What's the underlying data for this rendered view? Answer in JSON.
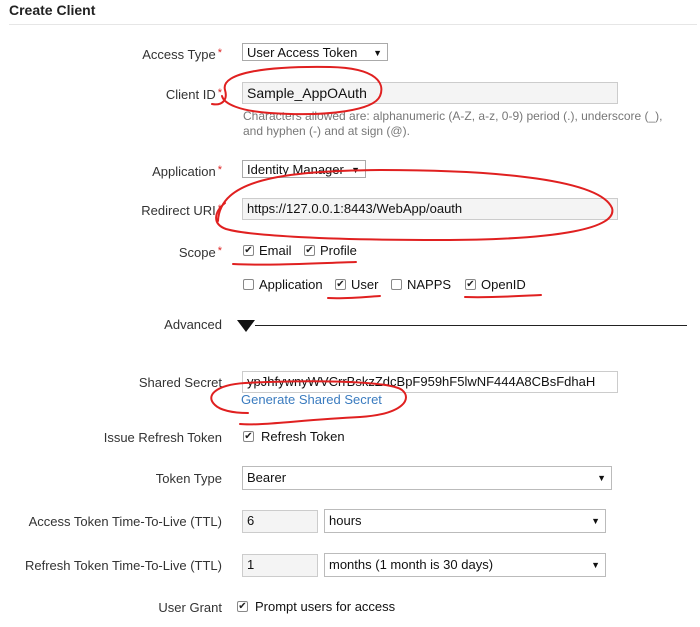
{
  "form": {
    "title": "Create Client",
    "access_type": {
      "label": "Access Type",
      "value": "User Access Token"
    },
    "client_id": {
      "label": "Client ID",
      "value": "Sample_AppOAuth",
      "help_line1": "Characters allowed are: alphanumeric (A-Z, a-z, 0-9) period (.), underscore (_),",
      "help_line2": "and hyphen (-) and at sign (@)."
    },
    "application": {
      "label": "Application",
      "value": "Identity Manager"
    },
    "redirect_uri": {
      "label": "Redirect URI",
      "value": "https://127.0.0.1:8443/WebApp/oauth"
    },
    "scope": {
      "label": "Scope",
      "options": [
        {
          "label": "Email",
          "checked": true
        },
        {
          "label": "Profile",
          "checked": true
        },
        {
          "label": "Application",
          "checked": false
        },
        {
          "label": "User",
          "checked": true
        },
        {
          "label": "NAPPS",
          "checked": false
        },
        {
          "label": "OpenID",
          "checked": true
        }
      ]
    },
    "advanced": {
      "label": "Advanced"
    },
    "shared_secret": {
      "label": "Shared Secret",
      "value": "ypJhfywnyWVCrrBskzZdcBpF959hF5lwNF444A8CBsFdhaH",
      "generate_link": "Generate Shared Secret"
    },
    "issue_refresh_token": {
      "label": "Issue Refresh Token",
      "option": "Refresh Token",
      "checked": true
    },
    "token_type": {
      "label": "Token Type",
      "value": "Bearer"
    },
    "access_ttl": {
      "label": "Access Token Time-To-Live (TTL)",
      "value": "6",
      "unit": "hours"
    },
    "refresh_ttl": {
      "label": "Refresh Token Time-To-Live (TTL)",
      "value": "1",
      "unit": "months (1 month is 30 days)"
    },
    "user_grant": {
      "label": "User Grant",
      "option": "Prompt users for access",
      "checked": true
    },
    "required_marker": "*",
    "check_mark": "✔",
    "dropdown_arrow": "▼",
    "annotation_color": "#e02020"
  }
}
